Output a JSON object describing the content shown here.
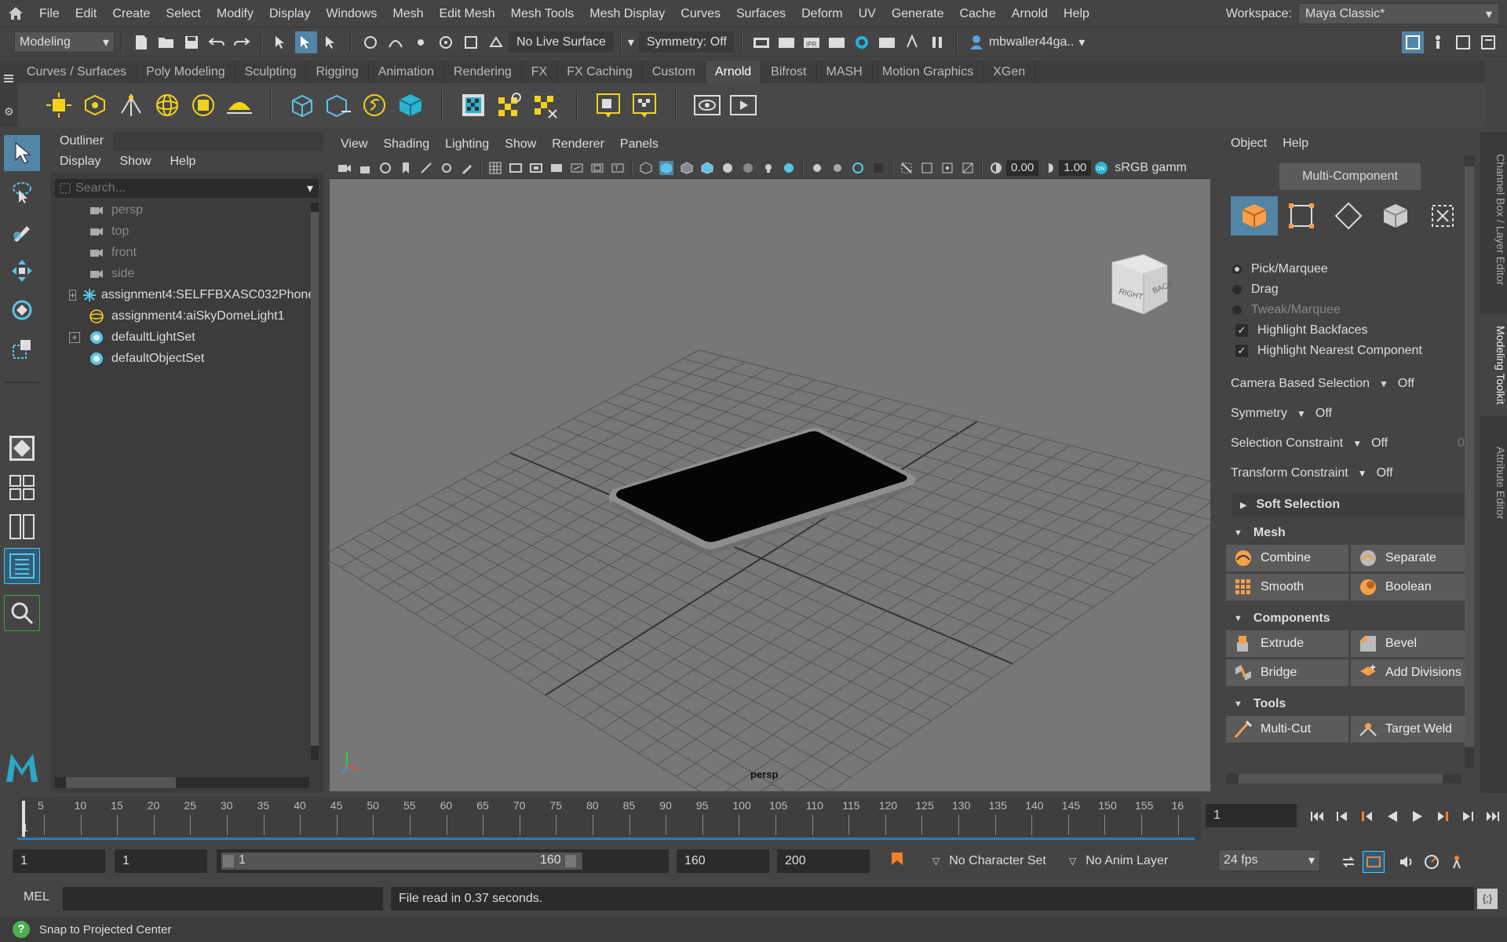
{
  "menu": {
    "items": [
      "File",
      "Edit",
      "Create",
      "Select",
      "Modify",
      "Display",
      "Windows",
      "Mesh",
      "Edit Mesh",
      "Mesh Tools",
      "Mesh Display",
      "Curves",
      "Surfaces",
      "Deform",
      "UV",
      "Generate",
      "Cache",
      "Arnold",
      "Help"
    ],
    "workspace_label": "Workspace:",
    "workspace_value": "Maya Classic*"
  },
  "statusline": {
    "mode": "Modeling",
    "live_surface": "No Live Surface",
    "symmetry": "Symmetry: Off",
    "user": "mbwaller44ga.."
  },
  "shelf": {
    "tabs": [
      "Curves / Surfaces",
      "Poly Modeling",
      "Sculpting",
      "Rigging",
      "Animation",
      "Rendering",
      "FX",
      "FX Caching",
      "Custom",
      "Arnold",
      "Bifrost",
      "MASH",
      "Motion Graphics",
      "XGen"
    ],
    "active_tab": "Arnold"
  },
  "outliner": {
    "tab": "Outliner",
    "menu": [
      "Display",
      "Show",
      "Help"
    ],
    "search_placeholder": "Search...",
    "items": [
      {
        "label": "persp",
        "dim": true,
        "expand": false
      },
      {
        "label": "top",
        "dim": true,
        "expand": false
      },
      {
        "label": "front",
        "dim": true,
        "expand": false
      },
      {
        "label": "side",
        "dim": true,
        "expand": false
      },
      {
        "label": "assignment4:SELFFBXASC032Phone",
        "dim": false,
        "expand": true
      },
      {
        "label": "assignment4:aiSkyDomeLight1",
        "dim": false,
        "expand": false
      },
      {
        "label": "defaultLightSet",
        "dim": false,
        "expand": true
      },
      {
        "label": "defaultObjectSet",
        "dim": false,
        "expand": false
      }
    ]
  },
  "viewport": {
    "menu": [
      "View",
      "Shading",
      "Lighting",
      "Show",
      "Renderer",
      "Panels"
    ],
    "exposure": "0.00",
    "gamma": "1.00",
    "colorspace": "sRGB gamm",
    "camera_label": "persp",
    "cube_right": "RIGHT",
    "cube_back": "BACK"
  },
  "toolkit": {
    "menu": [
      "Object",
      "Help"
    ],
    "mode_label": "Multi-Component",
    "selection_modes": [
      "Pick/Marquee",
      "Drag",
      "Tweak/Marquee"
    ],
    "highlight_backfaces": "Highlight Backfaces",
    "highlight_nearest": "Highlight Nearest Component",
    "camera_based": {
      "label": "Camera Based Selection",
      "value": "Off"
    },
    "symmetry": {
      "label": "Symmetry",
      "value": "Off"
    },
    "selection_constraint": {
      "label": "Selection Constraint",
      "value": "Off",
      "num": "0"
    },
    "transform_constraint": {
      "label": "Transform Constraint",
      "value": "Off"
    },
    "soft_selection": "Soft Selection",
    "mesh_section": "Mesh",
    "mesh_buttons": [
      "Combine",
      "Separate",
      "Smooth",
      "Boolean"
    ],
    "components_section": "Components",
    "component_buttons": [
      "Extrude",
      "Bevel",
      "Bridge",
      "Add Divisions"
    ],
    "tools_section": "Tools",
    "tool_buttons": [
      "Multi-Cut",
      "Target Weld"
    ]
  },
  "side_tabs": [
    "Channel Box / Layer Editor",
    "Modeling Toolkit",
    "Attribute Editor"
  ],
  "timeline": {
    "ticks": [
      "5",
      "10",
      "15",
      "20",
      "25",
      "30",
      "35",
      "40",
      "45",
      "50",
      "55",
      "60",
      "65",
      "70",
      "75",
      "80",
      "85",
      "90",
      "95",
      "100",
      "105",
      "110",
      "115",
      "120",
      "125",
      "130",
      "135",
      "140",
      "145",
      "150",
      "155",
      "16"
    ],
    "current_frame_marker": "1",
    "current_frame": "1"
  },
  "range": {
    "start": "1",
    "playback_start": "1",
    "slider_start": "1",
    "slider_end": "160",
    "playback_end": "160",
    "end": "200",
    "character_set": "No Character Set",
    "anim_layer": "No Anim Layer",
    "fps": "24 fps"
  },
  "command": {
    "language": "MEL",
    "result": "File read in  0.37 seconds."
  },
  "help_line": "Snap to Projected Center"
}
